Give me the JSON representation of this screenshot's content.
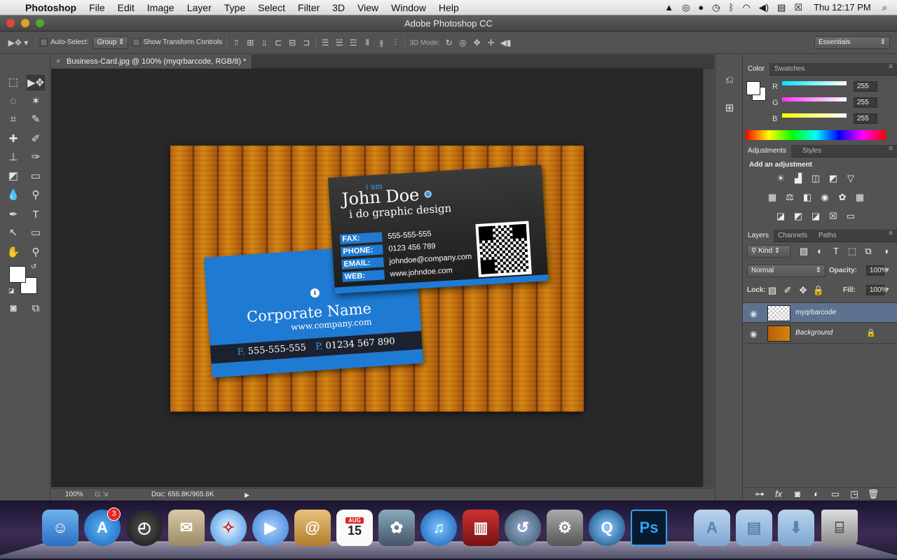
{
  "menubar": {
    "app_name": "Photoshop",
    "items": [
      "File",
      "Edit",
      "Image",
      "Layer",
      "Type",
      "Select",
      "Filter",
      "3D",
      "View",
      "Window",
      "Help"
    ],
    "clock": "Thu 12:17 PM"
  },
  "window": {
    "title": "Adobe Photoshop CC"
  },
  "options_bar": {
    "auto_select_label": "Auto-Select:",
    "auto_select_value": "Group",
    "show_transform_label": "Show Transform Controls",
    "mode_3d_label": "3D Mode:",
    "workspace": "Essentials"
  },
  "document": {
    "tab_title": "Business-Card.jpg @ 100% (myqrbarcode, RGB/8) *",
    "zoom": "100%",
    "doc_info": "Doc: 656.8K/965.6K"
  },
  "image": {
    "dark_card": {
      "i_am": "i am",
      "name": "John Doe",
      "tagline": "i do graphic design",
      "rows": [
        {
          "label": "FAX:",
          "value": "555-555-555"
        },
        {
          "label": "PHONE:",
          "value": "0123 456 789"
        },
        {
          "label": "EMAIL:",
          "value": "johndoe@company.com"
        },
        {
          "label": "WEB:",
          "value": "www.johndoe.com"
        }
      ]
    },
    "blue_card": {
      "corporate_name": "Corporate Name",
      "website": "www.company.com",
      "fax_prefix": "F.",
      "fax": "555-555-555",
      "phone_prefix": "P.",
      "phone": "01234 567 890"
    }
  },
  "color_panel": {
    "tabs": [
      "Color",
      "Swatches"
    ],
    "channels": [
      {
        "name": "R",
        "value": "255",
        "color": "#00e5ff"
      },
      {
        "name": "G",
        "value": "255",
        "color": "#ff33ff"
      },
      {
        "name": "B",
        "value": "255",
        "color": "#ffff00"
      }
    ]
  },
  "adjustments_panel": {
    "tabs": [
      "Adjustments",
      "Styles"
    ],
    "heading": "Add an adjustment"
  },
  "layers_panel": {
    "tabs": [
      "Layers",
      "Channels",
      "Paths"
    ],
    "kind_filter": "Kind",
    "blend_mode": "Normal",
    "opacity_label": "Opacity:",
    "opacity": "100%",
    "lock_label": "Lock:",
    "fill_label": "Fill:",
    "fill": "100%",
    "layers": [
      {
        "name": "myqrbarcode",
        "selected": true
      },
      {
        "name": "Background",
        "selected": false
      }
    ]
  },
  "dock": {
    "app_store_badge": "3",
    "calendar_month": "AUG",
    "calendar_day": "15",
    "photoshop_label": "Ps"
  }
}
